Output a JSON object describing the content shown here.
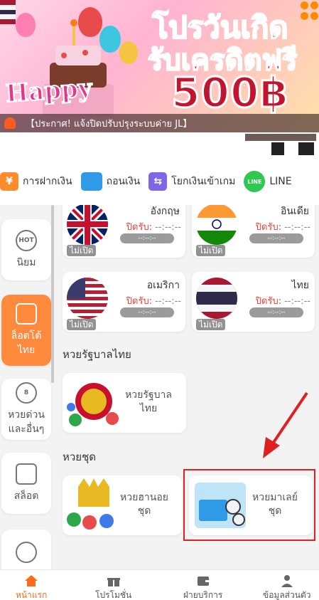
{
  "banner": {
    "line1": "โปรวันเกิด",
    "line2": "รับเครดิตฟรี",
    "line3": "500฿",
    "happy": "Happy"
  },
  "announcement": "【ประกาศ! แจ้งปิดปรับปรุงระบบค่าย JL】",
  "quick_actions": [
    {
      "label": "การฝากเงิน",
      "icon": "deposit-icon",
      "glyph": "¥"
    },
    {
      "label": "ถอนเงิน",
      "icon": "withdraw-icon",
      "glyph": ""
    },
    {
      "label": "โยกเงินเข้าเกม",
      "icon": "transfer-icon",
      "glyph": "⇆"
    },
    {
      "label": "LINE",
      "icon": "line-icon",
      "glyph": "LINE"
    }
  ],
  "sidebar": {
    "items": [
      {
        "label": "นิยม",
        "icon": "hot-icon",
        "glyph": "HOT"
      },
      {
        "label": "ล็อตโต้\nไทย",
        "icon": "lotto-icon",
        "glyph": ""
      },
      {
        "label": "หวยด่วน\nและอื่นๆ",
        "icon": "number-8-icon",
        "glyph": "8"
      },
      {
        "label": "สล็อต",
        "icon": "gamepad-icon",
        "glyph": ""
      },
      {
        "label": "",
        "icon": "fish-icon",
        "glyph": ""
      }
    ]
  },
  "countries": [
    {
      "name": "อังกฤษ",
      "close_label": "ปิดรับ:",
      "close_time": "--:--:--",
      "timer": "--:--:--",
      "status": "ไม่เปิด"
    },
    {
      "name": "อินเดีย",
      "close_label": "ปิดรับ:",
      "close_time": "--:--:--",
      "timer": "--:--:--",
      "status": "ไม่เปิด"
    },
    {
      "name": "อเมริกา",
      "close_label": "ปิดรับ:",
      "close_time": "--:--:--",
      "timer": "--:--:--",
      "status": "ไม่เปิด"
    },
    {
      "name": "ไทย",
      "close_label": "ปิดรับ:",
      "close_time": "--:--:--",
      "timer": "--:--:--",
      "status": "ไม่เปิด"
    }
  ],
  "sections": {
    "thai_gov": "หวยรัฐบาลไทย",
    "sets": "หวยชุด"
  },
  "games": {
    "thai_gov": "หวยรัฐบาล\nไทย",
    "hanoi_set": "หวยฮานอย\nชุด",
    "malay_set": "หวยมาเลย์\nชุด"
  },
  "bottom_nav": [
    {
      "label": "หน้าแรก",
      "icon": "home-icon"
    },
    {
      "label": "โปรโมชั่น",
      "icon": "gift-icon"
    },
    {
      "label": "ฝ่ายบริการ",
      "icon": "wallet-icon"
    },
    {
      "label": "ข้อมูลส่วนตัว",
      "icon": "user-icon"
    }
  ],
  "colors": {
    "accent": "#ff8a3d",
    "close_red": "#e8443a",
    "highlight": "#e02020"
  }
}
